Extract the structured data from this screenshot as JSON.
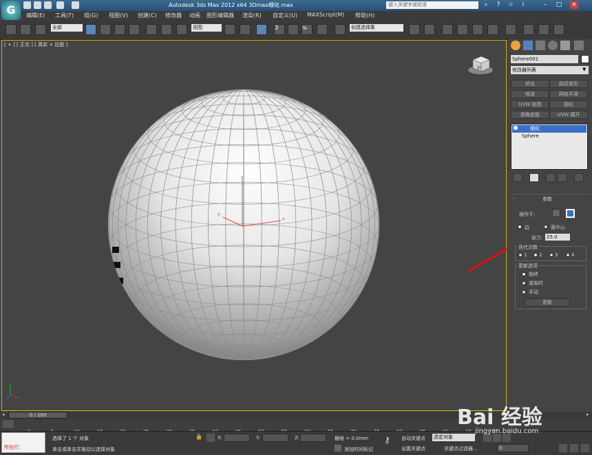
{
  "window": {
    "title": "Autodesk 3ds Max  2012 x64      3Dmax细化.max"
  },
  "search": {
    "placeholder": "键入关键字或短语"
  },
  "menu": [
    "编辑(E)",
    "工具(T)",
    "组(G)",
    "视图(V)",
    "创建(C)",
    "修改器",
    "动画",
    "图形编辑器",
    "渲染(R)",
    "自定义(U)",
    "MAXScript(M)",
    "帮助(H)"
  ],
  "toolbar": {
    "selection_filter": "全部",
    "ref_coord": "视图",
    "named_set": "创建选择集",
    "snap_label": "3",
    "percent_label": "%"
  },
  "viewport": {
    "label": "[ + ] [ 正交 ] [ 真实 + 边面 ]",
    "viewcube_label": "前"
  },
  "panel": {
    "object_name": "Sphere001",
    "modifier_list": "修改器列表",
    "modifier_buttons": [
      "挤出",
      "路径变形",
      "噪波",
      "网格平滑",
      "UVW 贴图",
      "细化",
      "倒角剖面",
      "UVW 展开"
    ],
    "stack": [
      "细化",
      "Sphere"
    ],
    "params_title": "参数",
    "operate_on": "操作于:",
    "edge_label": "边",
    "face_center_label": "面中心",
    "tension_label": "张力:",
    "tension_value": "25.0",
    "iterations_title": "迭代次数",
    "iterations": [
      "1",
      "2",
      "3",
      "4"
    ],
    "update_title": "更新选项",
    "update_options": [
      "始终",
      "渲染时",
      "手动"
    ],
    "update_button": "更新"
  },
  "timeline": {
    "frame": "0 / 100",
    "ticks": [
      "0",
      "5",
      "10",
      "15",
      "20",
      "25",
      "30",
      "35",
      "40",
      "45",
      "50",
      "55",
      "60",
      "65",
      "70",
      "75",
      "80",
      "85",
      "90",
      "95",
      "100"
    ]
  },
  "status": {
    "mode": "所在行：",
    "selected": "选择了 1 个 对象",
    "hint": "单击或单击并拖动以选择对象",
    "x_label": "X:",
    "y_label": "Y:",
    "z_label": "Z:",
    "grid": "栅格 = 0.0mm",
    "add_time_tag": "添加时间标记",
    "auto_key": "自动关键点",
    "set_key": "设置关键点",
    "key_filter_select": "选定对象",
    "key_filters": "关键点过滤器...",
    "frame_field": "0"
  },
  "watermark": {
    "brand": "Bai   经验",
    "url": "jingyan.baidu.com"
  },
  "colors": {
    "viewport_border": "#d7b600",
    "annotation": "#e01010",
    "selection_blue": "#3a6fc9"
  },
  "icons": [
    "app-logo-icon",
    "link-icon",
    "select-icon",
    "move-icon",
    "rotate-icon",
    "scale-icon",
    "create-tab-icon",
    "modify-tab-icon",
    "hierarchy-tab-icon",
    "motion-tab-icon",
    "display-tab-icon",
    "utilities-tab-icon",
    "pin-stack-icon",
    "show-end-result-icon",
    "make-unique-icon",
    "remove-modifier-icon",
    "configure-icon",
    "key-icon",
    "lock-icon"
  ]
}
